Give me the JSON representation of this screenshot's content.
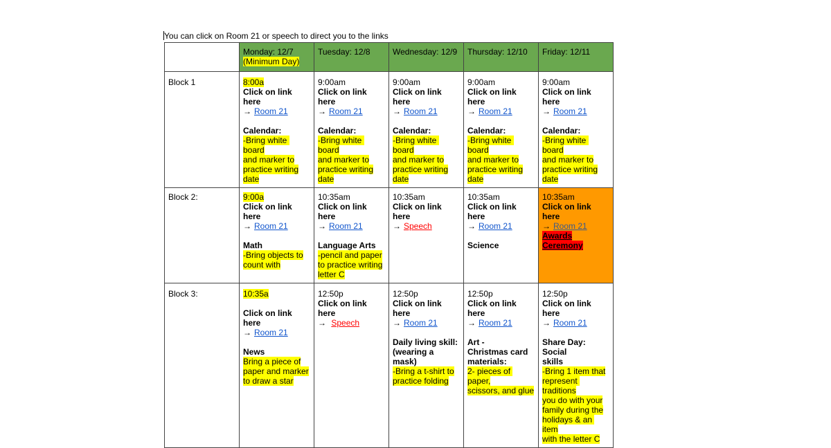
{
  "intro_text": "You can click on Room 21 or speech to direct you to the links",
  "colors": {
    "header_green": "#6aa84f",
    "highlight_yellow": "#ffff00",
    "highlight_red": "#ff0000",
    "cell_orange": "#ff9900",
    "link_blue": "#1155cc",
    "link_red": "#ff0000"
  },
  "header": {
    "days": [
      {
        "label": "Monday: 12/7",
        "note": "(Minimum Day)"
      },
      {
        "label": "Tuesday: 12/8"
      },
      {
        "label": "Wednesday: 12/9"
      },
      {
        "label": "Thursday: 12/10"
      },
      {
        "label": "Friday: 12/11"
      }
    ]
  },
  "common": {
    "click_text": "Click on link here",
    "arrow": "→",
    "room_link": "Room 21",
    "speech_link": "Speech"
  },
  "rows": [
    {
      "label": "Block 1",
      "cells": [
        {
          "time": "8:00a",
          "subject": "Calendar:",
          "lines": [
            "-Bring white board",
            "and marker to",
            "practice writing",
            "date"
          ]
        },
        {
          "time": "9:00am",
          "subject": "Calendar:",
          "lines": [
            "-Bring white board",
            "and marker to",
            "practice writing",
            "date"
          ]
        },
        {
          "time": "9:00am",
          "subject": "Calendar:",
          "lines": [
            "-Bring white board",
            "and marker to",
            "practice writing",
            "date"
          ]
        },
        {
          "time": "9:00am",
          "subject": "Calendar:",
          "lines": [
            "-Bring white board",
            "and marker to",
            "practice writing",
            "date"
          ]
        },
        {
          "time": "9:00am",
          "subject": "Calendar:",
          "lines": [
            "-Bring white board",
            "and marker to",
            "practice writing",
            "date"
          ]
        }
      ]
    },
    {
      "label": "Block 2:",
      "cells": [
        {
          "time": "9:00a",
          "subject": "Math",
          "lines": [
            "-Bring objects to",
            "count with"
          ]
        },
        {
          "time": "10:35am",
          "subject": "Language Arts",
          "lines": [
            "-pencil and paper",
            "to practice writing",
            "letter C"
          ]
        },
        {
          "time": "10:35am"
        },
        {
          "time": "10:35am",
          "subject": "Science"
        },
        {
          "time": "10:35am",
          "event": [
            "Awards",
            "Ceremony"
          ]
        }
      ]
    },
    {
      "label": "Block 3:",
      "cells": [
        {
          "time": "10:35a",
          "subject": "News",
          "lines": [
            "Bring a piece of",
            "paper and marker",
            "to draw a star"
          ]
        },
        {
          "time": "12:50p"
        },
        {
          "time": "12:50p",
          "subject_lines": [
            "Daily living skill:",
            "(wearing a mask)"
          ],
          "lines": [
            "-Bring a t-shirt to",
            "practice folding"
          ]
        },
        {
          "time": "12:50p",
          "subject_lines": [
            "Art -",
            "Christmas card",
            "materials:"
          ],
          "lines": [
            "2- pieces of paper,",
            "scissors, and glue"
          ]
        },
        {
          "time": "12:50p",
          "subject_lines": [
            "Share Day: Social",
            "skills"
          ],
          "lines": [
            "-Bring 1 item that",
            "represent traditions",
            "you do with your",
            "family during the",
            "holidays & an item",
            "with the letter C"
          ]
        }
      ]
    }
  ]
}
